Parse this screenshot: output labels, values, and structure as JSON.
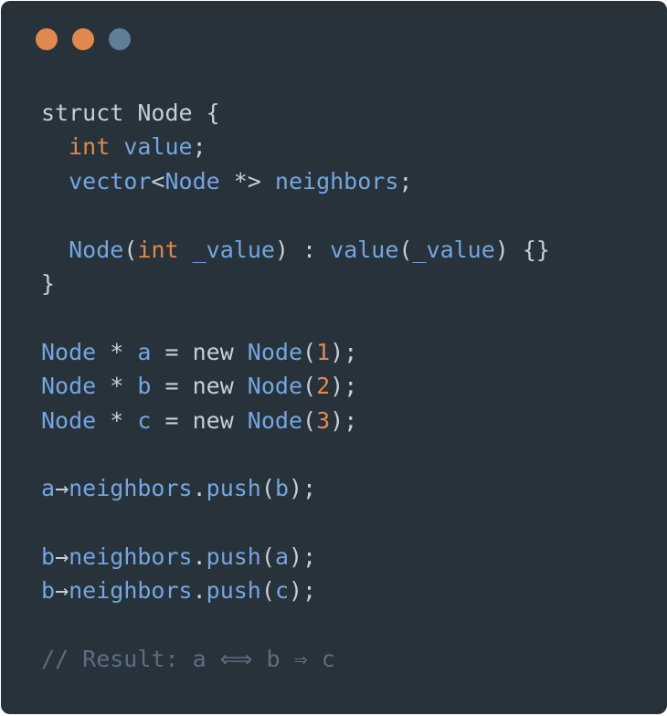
{
  "colors": {
    "background": "#28323a",
    "plain": "#c5cfd8",
    "type": "#74a6e0",
    "keyword": "#e0894f",
    "number": "#e0894f",
    "comment": "#5a6f82"
  },
  "window_controls": [
    {
      "name": "close",
      "color": "#e0894f"
    },
    {
      "name": "minimize",
      "color": "#e0894f"
    },
    {
      "name": "maximize",
      "color": "#5f7f99"
    }
  ],
  "code_lines": [
    [
      {
        "t": "struct ",
        "c": "plain"
      },
      {
        "t": "Node",
        "c": "plain"
      },
      {
        "t": " {",
        "c": "plain"
      }
    ],
    [
      {
        "t": "  ",
        "c": "plain"
      },
      {
        "t": "int",
        "c": "keyword"
      },
      {
        "t": " ",
        "c": "plain"
      },
      {
        "t": "value",
        "c": "type"
      },
      {
        "t": ";",
        "c": "plain"
      }
    ],
    [
      {
        "t": "  ",
        "c": "plain"
      },
      {
        "t": "vector",
        "c": "type"
      },
      {
        "t": "<",
        "c": "plain"
      },
      {
        "t": "Node",
        "c": "type"
      },
      {
        "t": " *> ",
        "c": "plain"
      },
      {
        "t": "neighbors",
        "c": "type"
      },
      {
        "t": ";",
        "c": "plain"
      }
    ],
    [],
    [
      {
        "t": "  ",
        "c": "plain"
      },
      {
        "t": "Node",
        "c": "type"
      },
      {
        "t": "(",
        "c": "plain"
      },
      {
        "t": "int",
        "c": "keyword"
      },
      {
        "t": " ",
        "c": "plain"
      },
      {
        "t": "_value",
        "c": "type"
      },
      {
        "t": ") : ",
        "c": "plain"
      },
      {
        "t": "value",
        "c": "type"
      },
      {
        "t": "(",
        "c": "plain"
      },
      {
        "t": "_value",
        "c": "type"
      },
      {
        "t": ") {}",
        "c": "plain"
      }
    ],
    [
      {
        "t": "}",
        "c": "plain"
      }
    ],
    [],
    [
      {
        "t": "Node",
        "c": "type"
      },
      {
        "t": " * ",
        "c": "plain"
      },
      {
        "t": "a",
        "c": "type"
      },
      {
        "t": " = new ",
        "c": "plain"
      },
      {
        "t": "Node",
        "c": "type"
      },
      {
        "t": "(",
        "c": "plain"
      },
      {
        "t": "1",
        "c": "number"
      },
      {
        "t": ");",
        "c": "plain"
      }
    ],
    [
      {
        "t": "Node",
        "c": "type"
      },
      {
        "t": " * ",
        "c": "plain"
      },
      {
        "t": "b",
        "c": "type"
      },
      {
        "t": " = new ",
        "c": "plain"
      },
      {
        "t": "Node",
        "c": "type"
      },
      {
        "t": "(",
        "c": "plain"
      },
      {
        "t": "2",
        "c": "number"
      },
      {
        "t": ");",
        "c": "plain"
      }
    ],
    [
      {
        "t": "Node",
        "c": "type"
      },
      {
        "t": " * ",
        "c": "plain"
      },
      {
        "t": "c",
        "c": "type"
      },
      {
        "t": " = new ",
        "c": "plain"
      },
      {
        "t": "Node",
        "c": "type"
      },
      {
        "t": "(",
        "c": "plain"
      },
      {
        "t": "3",
        "c": "number"
      },
      {
        "t": ");",
        "c": "plain"
      }
    ],
    [],
    [
      {
        "t": "a",
        "c": "type"
      },
      {
        "t": "→",
        "c": "plain"
      },
      {
        "t": "neighbors",
        "c": "type"
      },
      {
        "t": ".",
        "c": "plain"
      },
      {
        "t": "push",
        "c": "type"
      },
      {
        "t": "(",
        "c": "plain"
      },
      {
        "t": "b",
        "c": "type"
      },
      {
        "t": ");",
        "c": "plain"
      }
    ],
    [],
    [
      {
        "t": "b",
        "c": "type"
      },
      {
        "t": "→",
        "c": "plain"
      },
      {
        "t": "neighbors",
        "c": "type"
      },
      {
        "t": ".",
        "c": "plain"
      },
      {
        "t": "push",
        "c": "type"
      },
      {
        "t": "(",
        "c": "plain"
      },
      {
        "t": "a",
        "c": "type"
      },
      {
        "t": ");",
        "c": "plain"
      }
    ],
    [
      {
        "t": "b",
        "c": "type"
      },
      {
        "t": "→",
        "c": "plain"
      },
      {
        "t": "neighbors",
        "c": "type"
      },
      {
        "t": ".",
        "c": "plain"
      },
      {
        "t": "push",
        "c": "type"
      },
      {
        "t": "(",
        "c": "plain"
      },
      {
        "t": "c",
        "c": "type"
      },
      {
        "t": ");",
        "c": "plain"
      }
    ],
    [],
    [
      {
        "t": "// Result: a ⟺ b ⇒ c",
        "c": "comment"
      }
    ]
  ]
}
